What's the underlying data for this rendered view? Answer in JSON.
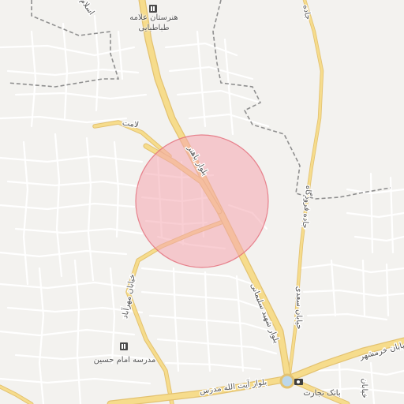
{
  "map": {
    "colors": {
      "background": "#f3f2ef",
      "street": "#ffffff",
      "street_casing": "#dddbd6",
      "major_road": "#f6dc8c",
      "major_road_casing": "#e3c271",
      "boundary": "#8f8f8f",
      "roundabout": "#bcd7ea",
      "highlight_fill": "#f4a6ae",
      "highlight_stroke": "#e46a78"
    },
    "highlight_area": {
      "shape": "circle"
    },
    "pois": [
      {
        "icon": "school-icon",
        "line1": "هنرستان علامه",
        "line2": "طباطبایی"
      },
      {
        "icon": "school-icon",
        "line1": "مدرسه امام حسین",
        "line2": ""
      },
      {
        "icon": "bank-icon",
        "line1": "بانک تجارت",
        "line2": ""
      }
    ],
    "roads": {
      "bahonar": "بلوار باهنر",
      "shahid_soleimani": "بلوار شهید سلیمانی",
      "ayatollah_modarres": "بلوار آیت الله مدرس",
      "khorramshahr": "خیابان خرمشهر",
      "saadi": "خیابان سعدی",
      "jadeh_forudgah": "جاده فرودگاه",
      "lamet": "لامت",
      "mehrabad": "خیابان مهرآباد",
      "eslam": "اسلام",
      "partial_top_right": "جاده",
      "partial_bottom_right": "خیابان"
    }
  }
}
